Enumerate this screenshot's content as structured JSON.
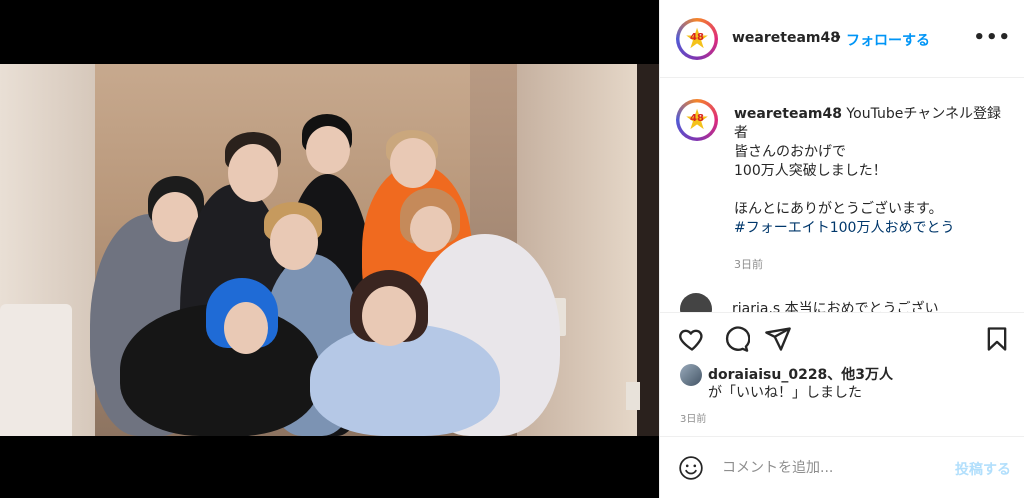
{
  "post": {
    "username": "weareteam48",
    "follow_label": "フォローする",
    "separator": "•",
    "more_label": "•••",
    "avatar_text": "48"
  },
  "caption": {
    "username": "weareteam48",
    "text_plain": " YouTubeチャンネル登録者\n皆さんのおかげで\n100万人突破しました！\n\nほんとにありがとうございます。",
    "hashtag": "#フォーエイト100万人おめでとう",
    "time": "3日前"
  },
  "comment_peek": {
    "text": "riaria.s 本当におめでとうござい"
  },
  "actions": {
    "like_icon": "heart-icon",
    "comment_icon": "comment-icon",
    "share_icon": "share-icon",
    "save_icon": "bookmark-icon"
  },
  "likes": {
    "line1": "doraiaisu_0228、他3万人",
    "line2": "が「いいね！」しました"
  },
  "post_time": "3日前",
  "comment_bar": {
    "placeholder": "コメントを追加...",
    "post_label": "投稿する",
    "emoji_icon": "emoji-icon"
  },
  "colors": {
    "accent": "#0095f6",
    "hashtag": "#00376b",
    "muted": "#8e8e8e",
    "post_disabled": "#b2dffc"
  }
}
